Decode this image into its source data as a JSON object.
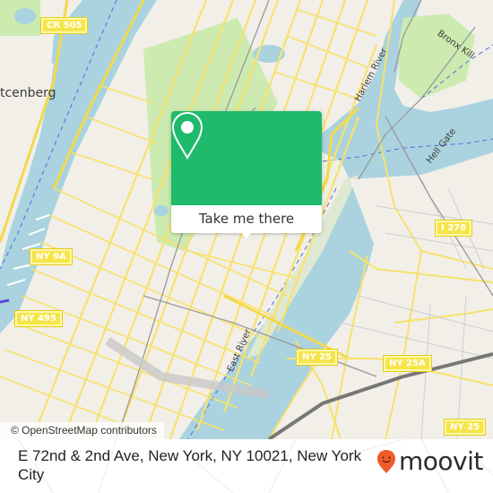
{
  "map": {
    "place_labels": [
      {
        "text": "tcenberg",
        "kind": "neighborhood"
      },
      {
        "text": "Harlem River",
        "kind": "water"
      },
      {
        "text": "Bronx Kill",
        "kind": "water"
      },
      {
        "text": "Hell Gate",
        "kind": "water"
      },
      {
        "text": "East River",
        "kind": "water"
      }
    ],
    "route_shields": [
      {
        "text": "CR 505"
      },
      {
        "text": "I 278"
      },
      {
        "text": "NY 9A"
      },
      {
        "text": "NY 495"
      },
      {
        "text": "NY 25"
      },
      {
        "text": "NY 25A"
      },
      {
        "text": "NY 25"
      }
    ],
    "colors": {
      "land": "#f2efe9",
      "water": "#aad3df",
      "park": "#cdebb0",
      "road": "#f7e26a",
      "rail": "#999999"
    },
    "attribution": "© OpenStreetMap contributors"
  },
  "popup": {
    "icon": "location-pin-icon",
    "button_label": "Take me there",
    "color": "#1fba6b"
  },
  "footer": {
    "address": "E 72nd & 2nd Ave, New York, NY 10021, New York City",
    "logo_text": "moovit",
    "logo_color": "#f15a2b"
  }
}
